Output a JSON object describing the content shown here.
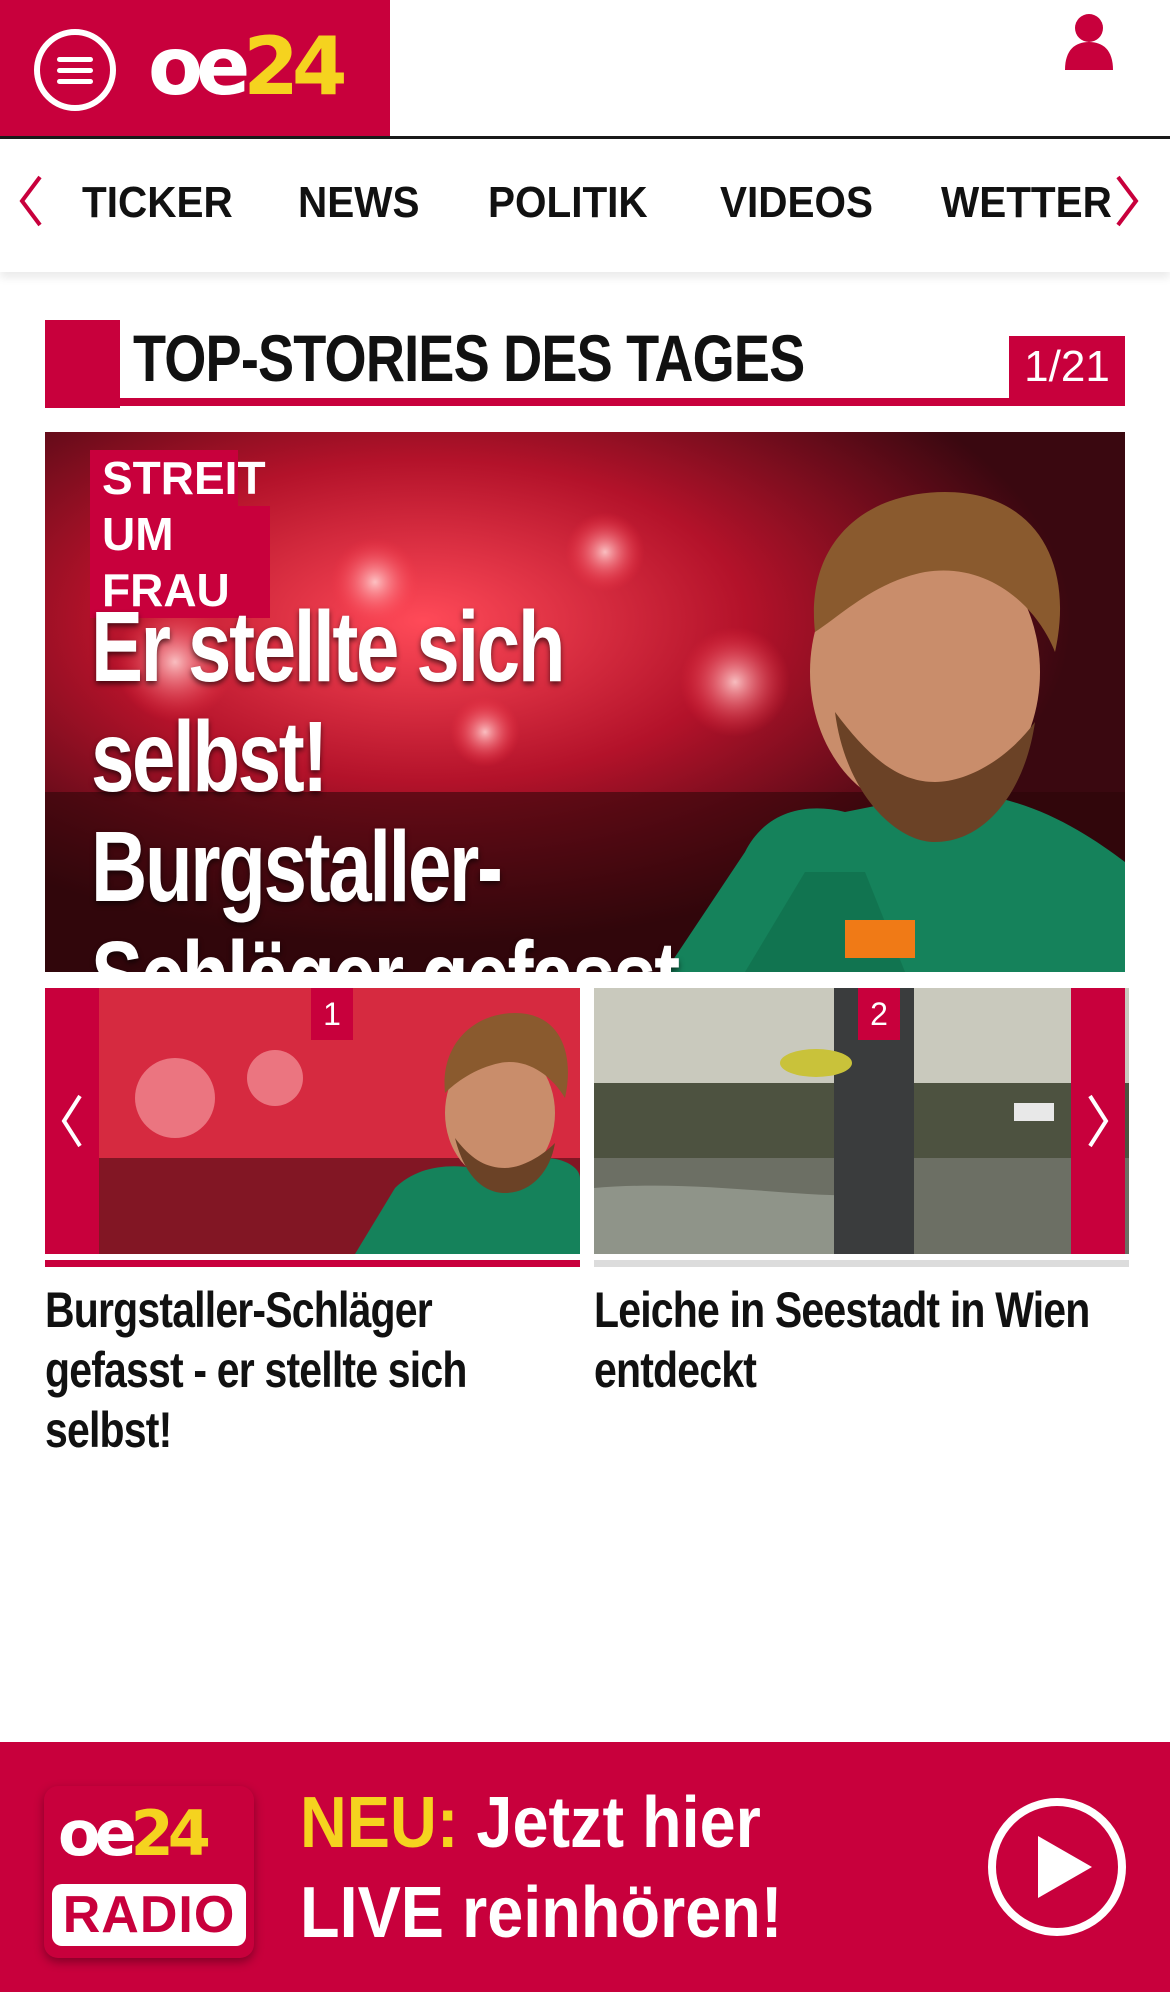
{
  "header": {
    "logo": {
      "part1": "oe",
      "part2": "24"
    },
    "menu_icon": "hamburger-menu-icon",
    "user_icon": "user-icon"
  },
  "nav": {
    "items": [
      "TICKER",
      "NEWS",
      "POLITIK",
      "VIDEOS",
      "WETTER"
    ]
  },
  "top_stories": {
    "title": "TOP-STORIES DES TAGES",
    "counter": "1/21",
    "hero": {
      "tag_line1": "STREIT",
      "tag_line2": "UM FRAU",
      "headline_l1": "Er stellte sich",
      "headline_l2": "selbst! Burgstaller-",
      "headline_l3": "Schläger gefasst"
    },
    "cards": [
      {
        "number": "1",
        "title": "Burgstaller-Schläger gefasst - er stellte sich selbst!"
      },
      {
        "number": "2",
        "title": "Leiche in Seestadt in Wien entdeckt"
      }
    ]
  },
  "radio": {
    "logo_top_part1": "oe",
    "logo_top_part2": "24",
    "logo_bottom": "RADIO",
    "highlight": "NEU:",
    "line1_rest": " Jetzt hier",
    "line2": "LIVE reinhören!"
  },
  "colors": {
    "brand_red": "#c8003c",
    "brand_yellow": "#f5d31f"
  }
}
